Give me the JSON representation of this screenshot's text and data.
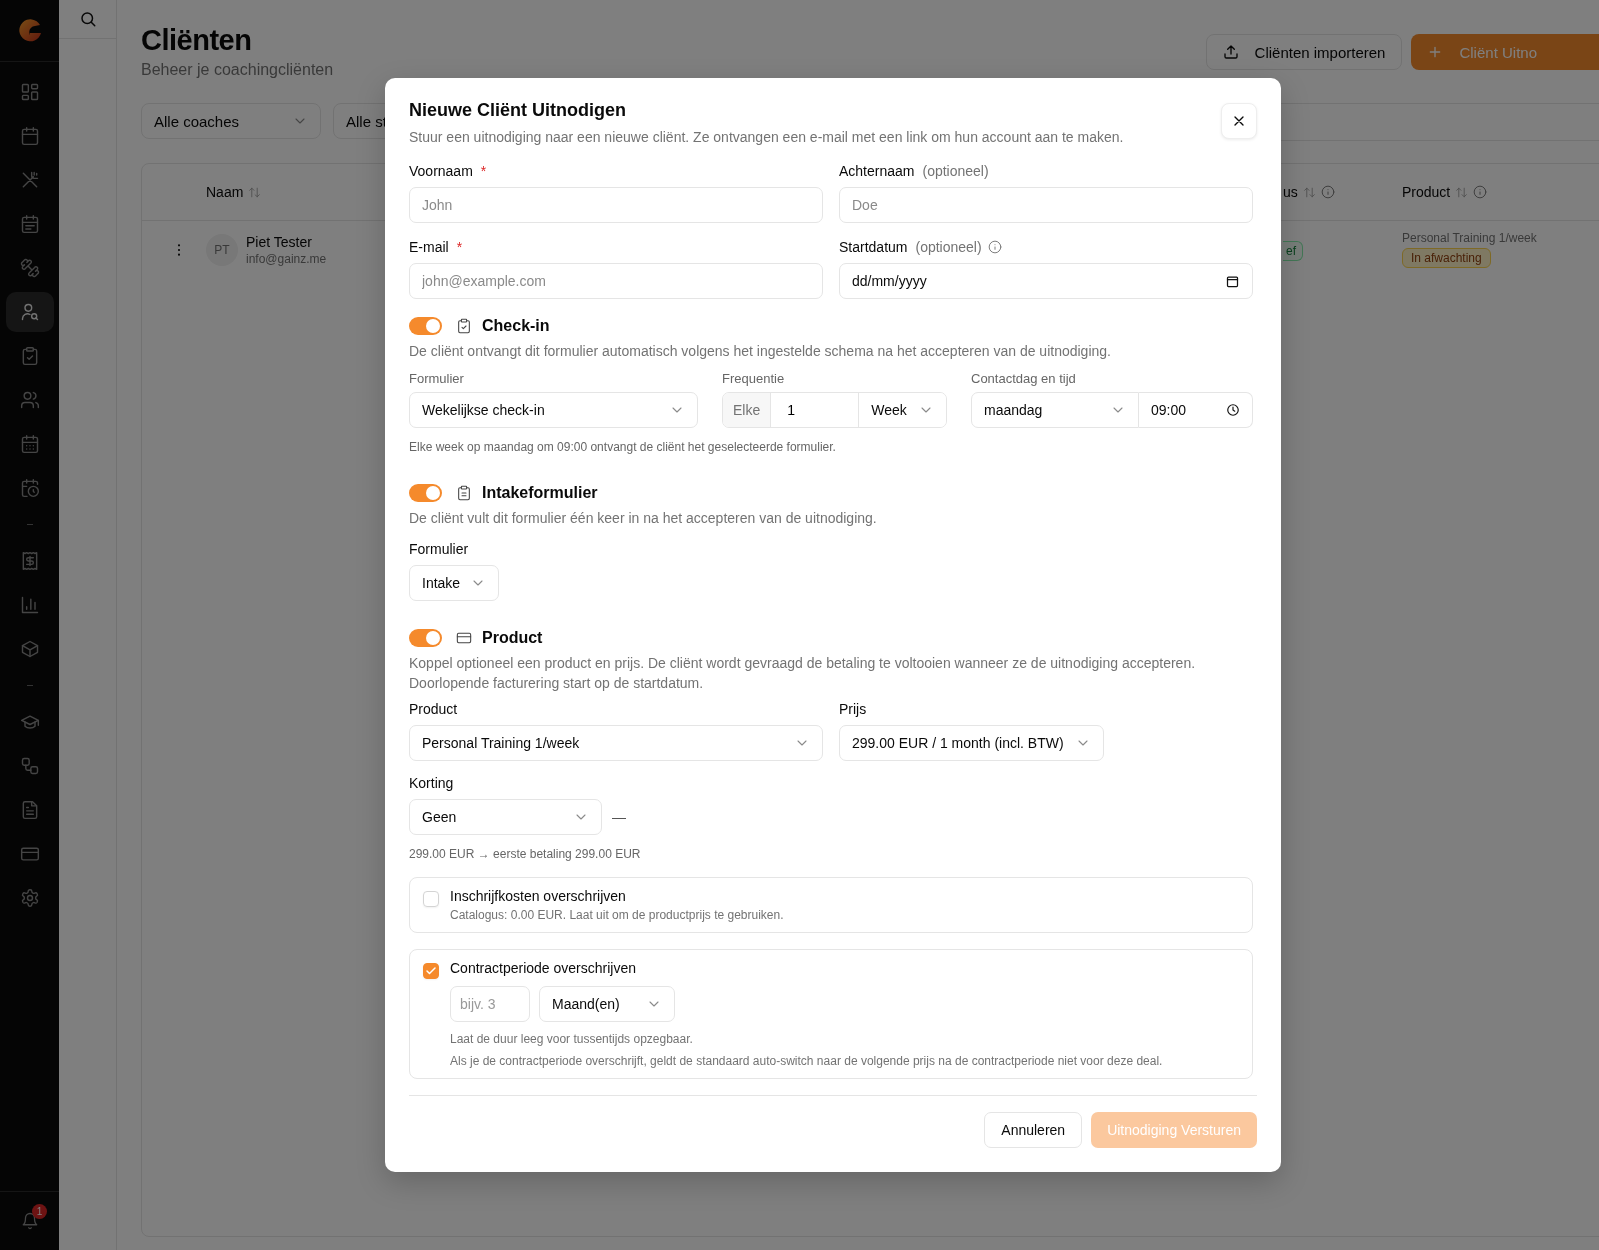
{
  "sidebar": {
    "items": [
      {
        "kind": "icon",
        "selected": false
      },
      {
        "kind": "icon",
        "selected": false
      },
      {
        "kind": "icon",
        "selected": false
      },
      {
        "kind": "icon",
        "selected": false
      },
      {
        "kind": "icon",
        "selected": false
      },
      {
        "kind": "icon",
        "selected": true
      },
      {
        "kind": "icon",
        "selected": false
      },
      {
        "kind": "icon",
        "selected": false
      },
      {
        "kind": "icon",
        "selected": false
      },
      {
        "kind": "icon",
        "selected": false
      },
      {
        "kind": "separator"
      },
      {
        "kind": "icon",
        "selected": false
      },
      {
        "kind": "icon",
        "selected": false
      },
      {
        "kind": "icon",
        "selected": false
      },
      {
        "kind": "separator"
      },
      {
        "kind": "icon",
        "selected": false
      },
      {
        "kind": "icon",
        "selected": false
      },
      {
        "kind": "icon",
        "selected": false
      },
      {
        "kind": "icon",
        "selected": false
      },
      {
        "kind": "icon",
        "selected": false
      }
    ],
    "notification_count": "1"
  },
  "page": {
    "title": "Cliënten",
    "subtitle": "Beheer je coachingcliënten",
    "actions": [
      {
        "label": "Cliënten importeren",
        "kind": "secondary"
      },
      {
        "label": "Cliënt Uitno",
        "kind": "primary"
      }
    ],
    "filters": [
      {
        "label": "Alle coaches"
      },
      {
        "label": "Alle st"
      }
    ]
  },
  "table": {
    "columns": [
      {
        "label": "Naam",
        "sortable": true,
        "info": false
      },
      {
        "label": "us",
        "sortable": true,
        "info": true
      },
      {
        "label": "Product",
        "sortable": true,
        "info": true
      }
    ],
    "rows": [
      {
        "initials": "PT",
        "name": "Piet Tester",
        "email": "info@gainz.me",
        "status": "ef",
        "product": "Personal Training 1/week",
        "payment": "In afwachting"
      }
    ]
  },
  "dialog": {
    "title": "Nieuwe Cliënt Uitnodigen",
    "description": "Stuur een uitnodiging naar een nieuwe cliënt. Ze ontvangen een e-mail met een link om hun account aan te maken.",
    "fields": [
      {
        "label": "Voornaam",
        "required_mark": "*",
        "placeholder": "John"
      },
      {
        "label": "Achternaam",
        "note": "(optioneel)",
        "placeholder": "Doe"
      },
      {
        "label": "E-mail",
        "required_mark": "*",
        "placeholder": "john@example.com"
      },
      {
        "label": "Startdatum",
        "note": "(optioneel)",
        "info": true,
        "kind": "date",
        "value": "dd/mm/yyyy"
      }
    ],
    "checkin": {
      "enabled": true,
      "title": "Check-in",
      "description": "De cliënt ontvangt dit formulier automatisch volgens het ingestelde schema na het accepteren van de uitnodiging.",
      "form": {
        "label": "Formulier",
        "value": "Wekelijkse check-in"
      },
      "frequency": {
        "label": "Frequentie",
        "prefix": "Elke",
        "value": "1",
        "unit": "Week"
      },
      "contact": {
        "label": "Contactdag en tijd",
        "day": "maandag",
        "time": "09:00"
      },
      "hint": "Elke week op maandag om 09:00 ontvangt de cliënt het geselecteerde formulier."
    },
    "intake": {
      "enabled": true,
      "title": "Intakeformulier",
      "description": "De cliënt vult dit formulier één keer in na het accepteren van de uitnodiging.",
      "form": {
        "label": "Formulier",
        "value": "Intake"
      }
    },
    "product": {
      "enabled": true,
      "title": "Product",
      "description": "Koppel optioneel een product en prijs. De cliënt wordt gevraagd de betaling te voltooien wanneer ze de uitnodiging accepteren. Doorlopende facturering start op de startdatum.",
      "product": {
        "label": "Product",
        "value": "Personal Training 1/week"
      },
      "price": {
        "label": "Prijs",
        "value": "299.00 EUR / 1 month (incl. BTW)"
      },
      "discount": {
        "label": "Korting",
        "value": "Geen",
        "suffix": "—"
      },
      "summary": "299.00 EUR → eerste betaling 299.00 EUR"
    },
    "overrides": [
      {
        "title": "Inschrijfkosten overschrijven",
        "checked": false,
        "description": "Catalogus: 0.00 EUR. Laat uit om de productprijs te gebruiken."
      },
      {
        "title": "Contractperiode overschrijven",
        "checked": true,
        "duration_placeholder": "bijv. 3",
        "unit": "Maand(en)",
        "notes": [
          "Laat de duur leeg voor tussentijds opzegbaar.",
          "Als je de contractperiode overschrijft, geldt de standaard auto-switch naar de volgende prijs na de contractperiode niet voor deze deal."
        ]
      }
    ],
    "buttons": [
      {
        "label": "Annuleren",
        "kind": "secondary",
        "disabled": false
      },
      {
        "label": "Uitnodiging Versturen",
        "kind": "primary",
        "disabled": true
      }
    ]
  }
}
